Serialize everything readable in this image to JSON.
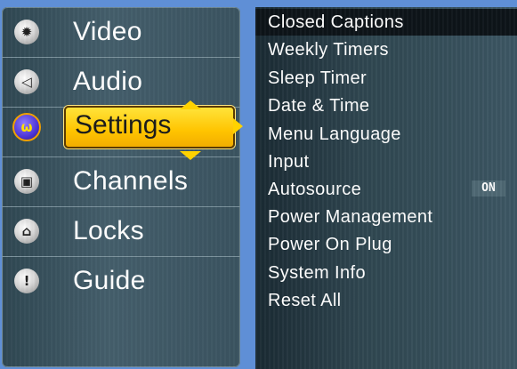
{
  "main_menu": {
    "items": [
      {
        "label": "Video",
        "icon": "gear-icon"
      },
      {
        "label": "Audio",
        "icon": "speaker-icon"
      },
      {
        "label": "Settings",
        "icon": "settings-icon"
      },
      {
        "label": "Channels",
        "icon": "tv-icon"
      },
      {
        "label": "Locks",
        "icon": "lock-icon"
      },
      {
        "label": "Guide",
        "icon": "info-icon"
      }
    ],
    "selected_index": 2
  },
  "submenu": {
    "items": [
      {
        "label": "Closed Captions"
      },
      {
        "label": "Weekly Timers"
      },
      {
        "label": "Sleep Timer"
      },
      {
        "label": "Date & Time"
      },
      {
        "label": "Menu Language"
      },
      {
        "label": "Input"
      },
      {
        "label": "Autosource",
        "value": "ON"
      },
      {
        "label": "Power Management"
      },
      {
        "label": "Power On Plug"
      },
      {
        "label": "System Info"
      },
      {
        "label": "Reset All"
      }
    ],
    "highlighted_index": 0
  },
  "colors": {
    "selection": "#ffd200",
    "background": "#5f8fd6"
  }
}
